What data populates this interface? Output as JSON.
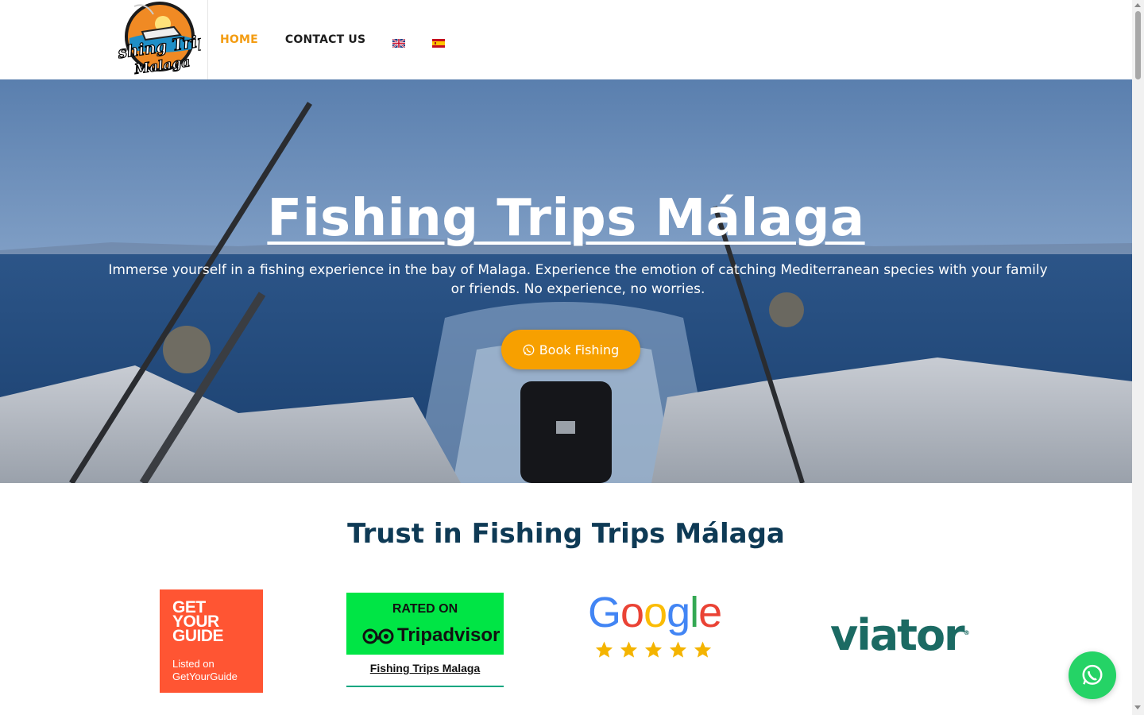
{
  "header": {
    "logo_text": "Fishing Trips Malaga",
    "nav": [
      {
        "label": "HOME"
      },
      {
        "label": "CONTACT US"
      }
    ],
    "flags": [
      "english-flag-icon",
      "spanish-flag-icon"
    ]
  },
  "hero": {
    "title": "Fishing Trips Málaga",
    "subtitle": "Immerse yourself in a fishing experience in the bay of Malaga. Experience the emotion of catching Mediterranean species with your family or friends. No experience, no worries.",
    "button_label": "Book Fishing",
    "button_icon": "whatsapp-icon"
  },
  "trust": {
    "title": "Trust in Fishing Trips Málaga",
    "getyourguide": {
      "line1": "GET",
      "line2": "YOUR",
      "line3": "GUIDE",
      "listed1": "Listed on",
      "listed2": "GetYourGuide"
    },
    "tripadvisor": {
      "rated": "RATED ON",
      "brand": "Tripadvisor",
      "name": "Fishing Trips Malaga"
    },
    "google": {
      "word": "Google",
      "stars": 5
    },
    "viator": {
      "word": "viator"
    }
  },
  "colors": {
    "accent": "#f39c12",
    "button": "#f7a000",
    "title_dark": "#0e3a55",
    "whatsapp": "#25d366"
  }
}
